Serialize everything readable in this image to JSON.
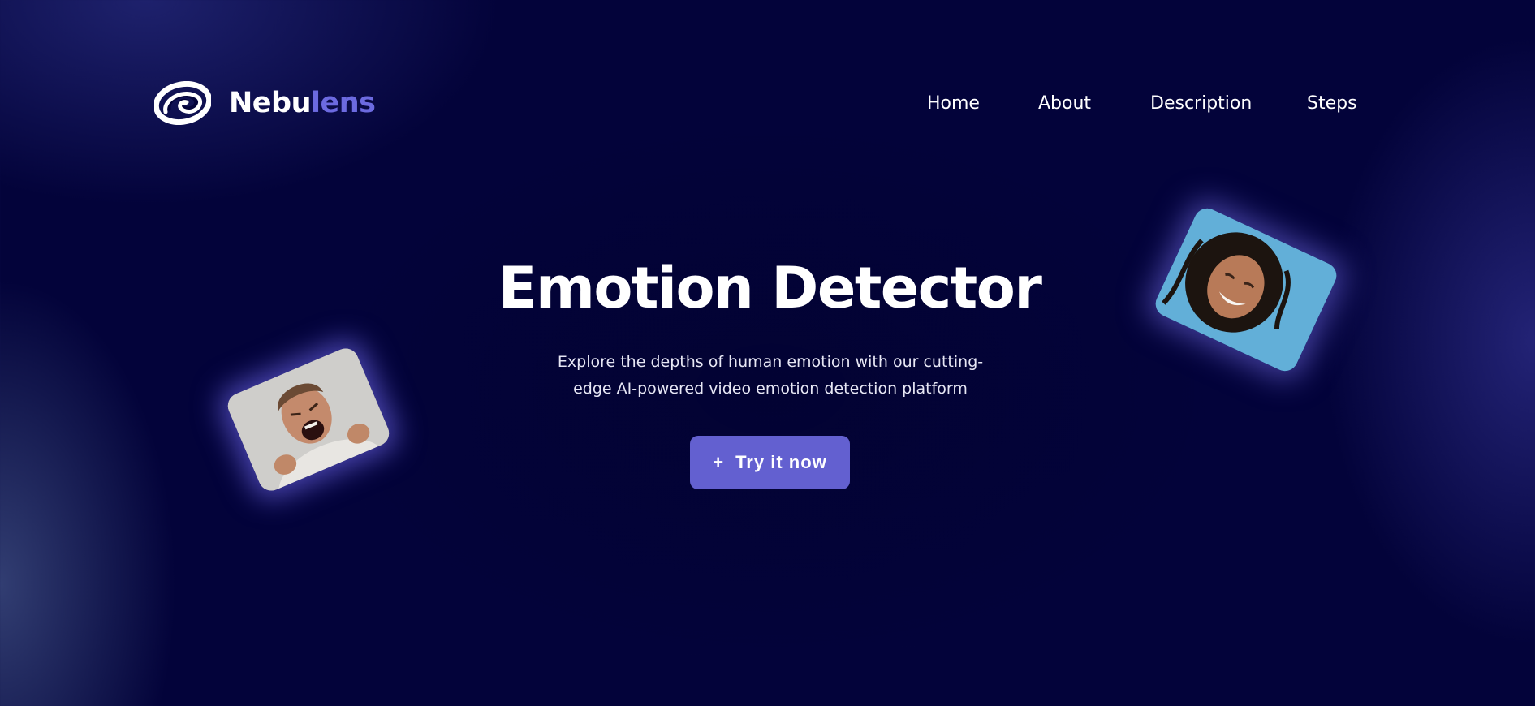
{
  "brand": {
    "name_part1": "Nebu",
    "name_part2": "lens",
    "logo_icon": "spiral-galaxy-icon"
  },
  "nav": {
    "items": [
      {
        "label": "Home"
      },
      {
        "label": "About"
      },
      {
        "label": "Description"
      },
      {
        "label": "Steps"
      }
    ]
  },
  "hero": {
    "title": "Emotion Detector",
    "subtitle_line1": "Explore the depths of human emotion with our cutting-",
    "subtitle_line2": "edge AI-powered video emotion detection platform",
    "cta_icon": "+",
    "cta_label": "Try it now"
  },
  "photos": {
    "left": {
      "alt": "angry-man-photo"
    },
    "right": {
      "alt": "smiling-woman-photo"
    }
  },
  "colors": {
    "background": "#03033a",
    "accent": "#6360d0",
    "brand_secondary": "#6c6ae0",
    "text": "#ffffff"
  }
}
